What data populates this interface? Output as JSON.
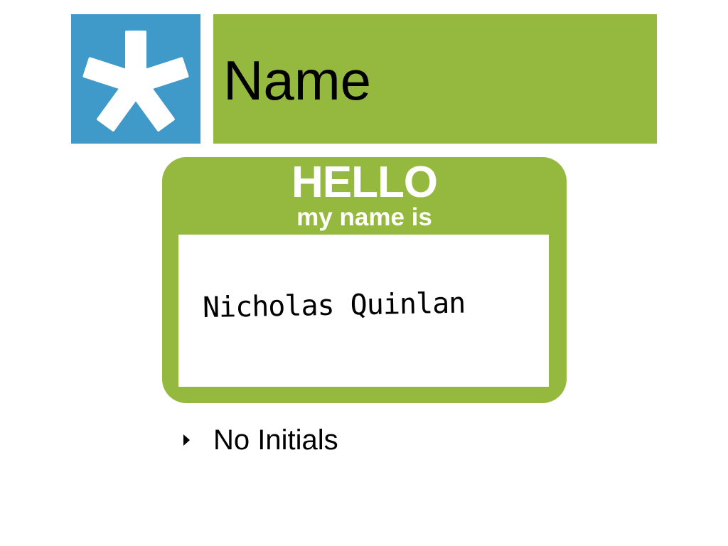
{
  "header": {
    "icon": "asterisk-icon",
    "title": "Name"
  },
  "name_tag": {
    "greeting": "HELLO",
    "subtitle": "my name is",
    "handwritten_name": "Nicholas Quinlan"
  },
  "bullets": [
    {
      "text": "No Initials"
    }
  ],
  "colors": {
    "icon_background": "#3f9ac9",
    "accent_green": "#95b83e",
    "text": "#000000",
    "tag_text": "#ffffff"
  }
}
